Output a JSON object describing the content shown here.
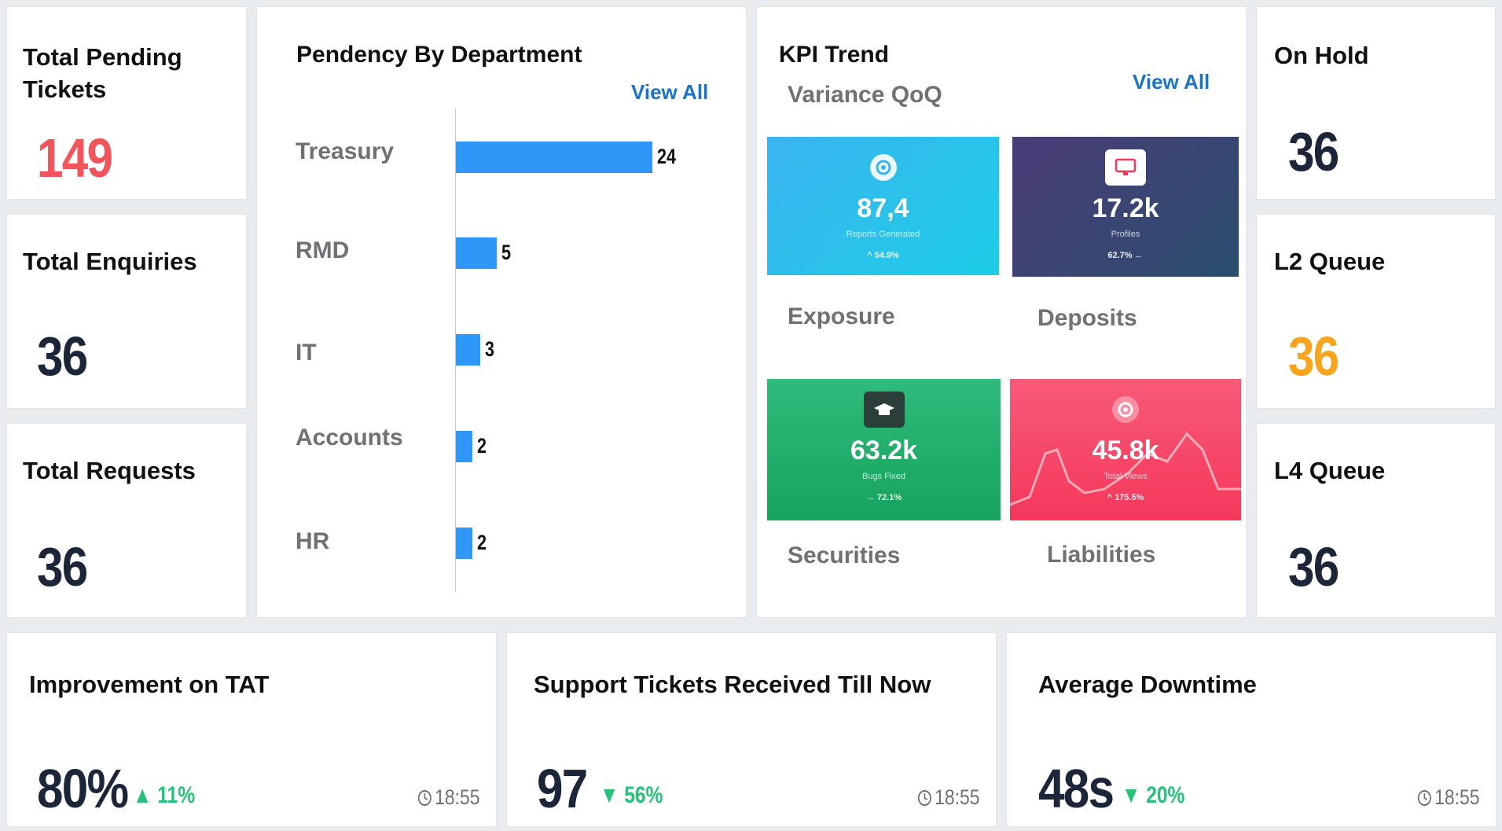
{
  "cards": {
    "total_pending": {
      "title_line1": "Total Pending",
      "title_line2": "Tickets",
      "value": "149"
    },
    "total_enquiries": {
      "title": "Total Enquiries",
      "value": "36"
    },
    "total_requests": {
      "title": "Total Requests",
      "value": "36"
    },
    "on_hold": {
      "title": "On Hold",
      "value": "36"
    },
    "l2_queue": {
      "title": "L2 Queue",
      "value": "36"
    },
    "l4_queue": {
      "title": "L4 Queue",
      "value": "36"
    }
  },
  "pendency": {
    "title": "Pendency By Department",
    "view_all": "View All"
  },
  "chart_data": {
    "type": "bar",
    "orientation": "horizontal",
    "title": "Pendency By Department",
    "categories": [
      "Treasury",
      "RMD",
      "IT",
      "Accounts",
      "HR"
    ],
    "values": [
      24,
      5,
      3,
      2,
      2
    ],
    "xlim": [
      0,
      24
    ],
    "grid": false,
    "data_labels": true
  },
  "kpi": {
    "title": "KPI Trend",
    "subtitle": "Variance QoQ",
    "view_all": "View All",
    "labels": [
      "Exposure",
      "Deposits",
      "Securities",
      "Liabilities"
    ],
    "tiles": [
      {
        "value": "87,4",
        "sub": "Reports Generated",
        "change": "^ 54.9%",
        "icon": "gear-icon",
        "color_from": "#3ab4f0",
        "color_to": "#1dcde6"
      },
      {
        "value": "17.2k",
        "sub": "Profiles",
        "change": "62.7% ←",
        "icon": "monitor-icon",
        "color_from": "#4a3c78",
        "color_to": "#2b4e6e"
      },
      {
        "value": "63.2k",
        "sub": "Bugs Fixed",
        "change": "→ 72.1%",
        "icon": "graduation-cap-icon",
        "color_from": "#2ebb7b",
        "color_to": "#16a35f"
      },
      {
        "value": "45.8k",
        "sub": "Total Views",
        "change": "^ 175.5%",
        "icon": "gear-icon",
        "color_from": "#f85a78",
        "color_to": "#f4385a"
      }
    ]
  },
  "bottom": {
    "tat": {
      "title": "Improvement on TAT",
      "value": "80%",
      "change": "11%",
      "direction": "up",
      "time": "18:55"
    },
    "support": {
      "title": "Support Tickets Received Till Now",
      "value": "97",
      "change": "56%",
      "direction": "down",
      "time": "18:55"
    },
    "downtime": {
      "title": "Average Downtime",
      "value": "48s",
      "change": "20%",
      "direction": "down",
      "time": "18:55"
    }
  },
  "colors": {
    "pending_red": "#f2545b",
    "queue_orange": "#f8a41c",
    "number_navy": "#1b2638",
    "bar_blue": "#2f97f7",
    "link_blue": "#1a73c8",
    "positive_green": "#27c27a"
  }
}
